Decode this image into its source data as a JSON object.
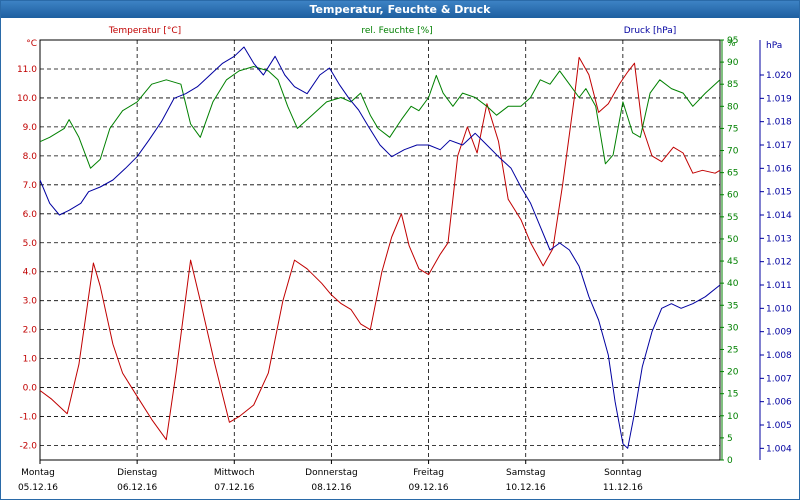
{
  "window": {
    "title": "Temperatur, Feuchte & Druck"
  },
  "colors": {
    "temperature": "#c00000",
    "humidity": "#008000",
    "pressure": "#0000a0",
    "grid": "#000000"
  },
  "chart_data": {
    "type": "line",
    "title": "Temperatur, Feuchte & Druck",
    "headers": {
      "temperature": "Temperatur [°C]",
      "humidity": "rel. Feuchte [%]",
      "pressure": "Druck [hPa]"
    },
    "axes": {
      "temperature": {
        "unit": "°C",
        "range": [
          -2.5,
          12.0
        ],
        "ticks": [
          "11.0",
          "10.0",
          "9.0",
          "8.0",
          "7.0",
          "6.0",
          "5.0",
          "4.0",
          "3.0",
          "2.0",
          "1.0",
          "0.0",
          "-1.0",
          "-2.0"
        ]
      },
      "humidity": {
        "unit": "%",
        "range": [
          0,
          95
        ],
        "ticks": [
          "95",
          "90",
          "85",
          "80",
          "75",
          "70",
          "65",
          "60",
          "55",
          "50",
          "45",
          "40",
          "35",
          "30",
          "25",
          "20",
          "15",
          "10",
          "5",
          "0"
        ]
      },
      "pressure": {
        "unit": "hPa",
        "range": [
          1.0035,
          1.0215
        ],
        "ticks": [
          "1.020",
          "1.019",
          "1.018",
          "1.017",
          "1.016",
          "1.015",
          "1.014",
          "1.013",
          "1.012",
          "1.011",
          "1.010",
          "1.009",
          "1.008",
          "1.007",
          "1.006",
          "1.005",
          "1.004"
        ]
      }
    },
    "x_range_days": [
      0,
      7
    ],
    "days": [
      {
        "weekday": "Montag",
        "date": "05.12.16"
      },
      {
        "weekday": "Dienstag",
        "date": "06.12.16"
      },
      {
        "weekday": "Mittwoch",
        "date": "07.12.16"
      },
      {
        "weekday": "Donnerstag",
        "date": "08.12.16"
      },
      {
        "weekday": "Freitag",
        "date": "09.12.16"
      },
      {
        "weekday": "Samstag",
        "date": "10.12.16"
      },
      {
        "weekday": "Sonntag",
        "date": "11.12.16"
      }
    ],
    "grid": true,
    "series": [
      {
        "name": "Temperatur [°C]",
        "axis": "temperature",
        "points": [
          [
            0,
            -0.1
          ],
          [
            0.12,
            -0.4
          ],
          [
            0.28,
            -0.9
          ],
          [
            0.4,
            0.8
          ],
          [
            0.55,
            4.3
          ],
          [
            0.62,
            3.5
          ],
          [
            0.75,
            1.5
          ],
          [
            0.85,
            0.5
          ],
          [
            1.0,
            -0.3
          ],
          [
            1.15,
            -1.1
          ],
          [
            1.3,
            -1.8
          ],
          [
            1.4,
            0.5
          ],
          [
            1.55,
            4.4
          ],
          [
            1.65,
            3.0
          ],
          [
            1.8,
            0.8
          ],
          [
            1.95,
            -1.2
          ],
          [
            2.05,
            -1.0
          ],
          [
            2.2,
            -0.6
          ],
          [
            2.35,
            0.5
          ],
          [
            2.5,
            3.0
          ],
          [
            2.62,
            4.4
          ],
          [
            2.75,
            4.1
          ],
          [
            2.9,
            3.6
          ],
          [
            3.0,
            3.2
          ],
          [
            3.1,
            2.9
          ],
          [
            3.2,
            2.7
          ],
          [
            3.3,
            2.2
          ],
          [
            3.4,
            2.0
          ],
          [
            3.52,
            4.0
          ],
          [
            3.62,
            5.2
          ],
          [
            3.72,
            6.0
          ],
          [
            3.8,
            4.9
          ],
          [
            3.9,
            4.1
          ],
          [
            4.0,
            3.9
          ],
          [
            4.12,
            4.6
          ],
          [
            4.2,
            5.0
          ],
          [
            4.3,
            8.0
          ],
          [
            4.4,
            9.0
          ],
          [
            4.5,
            8.1
          ],
          [
            4.6,
            9.8
          ],
          [
            4.72,
            8.5
          ],
          [
            4.82,
            6.5
          ],
          [
            4.95,
            5.8
          ],
          [
            5.05,
            5.0
          ],
          [
            5.18,
            4.2
          ],
          [
            5.28,
            4.8
          ],
          [
            5.38,
            7.0
          ],
          [
            5.5,
            10.0
          ],
          [
            5.55,
            11.4
          ],
          [
            5.65,
            10.8
          ],
          [
            5.75,
            9.5
          ],
          [
            5.85,
            9.8
          ],
          [
            5.97,
            10.5
          ],
          [
            6.05,
            10.9
          ],
          [
            6.12,
            11.2
          ],
          [
            6.2,
            9.0
          ],
          [
            6.3,
            8.0
          ],
          [
            6.4,
            7.8
          ],
          [
            6.52,
            8.3
          ],
          [
            6.62,
            8.1
          ],
          [
            6.72,
            7.4
          ],
          [
            6.82,
            7.5
          ],
          [
            6.95,
            7.4
          ],
          [
            7.0,
            7.5
          ]
        ]
      },
      {
        "name": "rel. Feuchte [%]",
        "axis": "humidity",
        "points": [
          [
            0,
            72
          ],
          [
            0.1,
            73
          ],
          [
            0.25,
            75
          ],
          [
            0.3,
            77
          ],
          [
            0.4,
            73
          ],
          [
            0.52,
            66
          ],
          [
            0.62,
            68
          ],
          [
            0.72,
            75
          ],
          [
            0.85,
            79
          ],
          [
            1.0,
            81
          ],
          [
            1.15,
            85
          ],
          [
            1.3,
            86
          ],
          [
            1.45,
            85
          ],
          [
            1.55,
            76
          ],
          [
            1.65,
            73
          ],
          [
            1.78,
            81
          ],
          [
            1.92,
            86
          ],
          [
            2.05,
            88
          ],
          [
            2.2,
            89
          ],
          [
            2.35,
            88
          ],
          [
            2.45,
            86
          ],
          [
            2.55,
            80
          ],
          [
            2.65,
            75
          ],
          [
            2.8,
            78
          ],
          [
            2.95,
            81
          ],
          [
            3.1,
            82
          ],
          [
            3.2,
            81
          ],
          [
            3.3,
            83
          ],
          [
            3.4,
            78
          ],
          [
            3.48,
            75
          ],
          [
            3.6,
            73
          ],
          [
            3.72,
            77
          ],
          [
            3.82,
            80
          ],
          [
            3.9,
            79
          ],
          [
            4.0,
            82
          ],
          [
            4.08,
            87
          ],
          [
            4.15,
            83
          ],
          [
            4.25,
            80
          ],
          [
            4.35,
            83
          ],
          [
            4.48,
            82
          ],
          [
            4.6,
            80
          ],
          [
            4.7,
            78
          ],
          [
            4.82,
            80
          ],
          [
            4.95,
            80
          ],
          [
            5.05,
            82
          ],
          [
            5.15,
            86
          ],
          [
            5.25,
            85
          ],
          [
            5.35,
            88
          ],
          [
            5.45,
            85
          ],
          [
            5.55,
            82
          ],
          [
            5.62,
            84
          ],
          [
            5.72,
            80
          ],
          [
            5.82,
            67
          ],
          [
            5.9,
            69
          ],
          [
            6.0,
            81
          ],
          [
            6.1,
            74
          ],
          [
            6.18,
            73
          ],
          [
            6.28,
            83
          ],
          [
            6.38,
            86
          ],
          [
            6.5,
            84
          ],
          [
            6.62,
            83
          ],
          [
            6.72,
            80
          ],
          [
            6.85,
            83
          ],
          [
            7.0,
            86
          ]
        ]
      },
      {
        "name": "Druck [hPa]",
        "axis": "pressure",
        "points": [
          [
            0,
            1.0155
          ],
          [
            0.1,
            1.0145
          ],
          [
            0.2,
            1.014
          ],
          [
            0.3,
            1.0142
          ],
          [
            0.42,
            1.0145
          ],
          [
            0.5,
            1.015
          ],
          [
            0.62,
            1.0152
          ],
          [
            0.75,
            1.0155
          ],
          [
            0.88,
            1.016
          ],
          [
            1.0,
            1.0165
          ],
          [
            1.12,
            1.0172
          ],
          [
            1.25,
            1.018
          ],
          [
            1.38,
            1.019
          ],
          [
            1.5,
            1.0192
          ],
          [
            1.62,
            1.0195
          ],
          [
            1.75,
            1.02
          ],
          [
            1.88,
            1.0205
          ],
          [
            2.0,
            1.0208
          ],
          [
            2.1,
            1.0212
          ],
          [
            2.2,
            1.0205
          ],
          [
            2.3,
            1.02
          ],
          [
            2.42,
            1.0208
          ],
          [
            2.52,
            1.02
          ],
          [
            2.62,
            1.0195
          ],
          [
            2.75,
            1.0192
          ],
          [
            2.88,
            1.02
          ],
          [
            2.98,
            1.0203
          ],
          [
            3.08,
            1.0196
          ],
          [
            3.18,
            1.019
          ],
          [
            3.28,
            1.0185
          ],
          [
            3.38,
            1.0178
          ],
          [
            3.5,
            1.017
          ],
          [
            3.62,
            1.0165
          ],
          [
            3.75,
            1.0168
          ],
          [
            3.88,
            1.017
          ],
          [
            4.0,
            1.017
          ],
          [
            4.12,
            1.0168
          ],
          [
            4.22,
            1.0172
          ],
          [
            4.35,
            1.017
          ],
          [
            4.48,
            1.0175
          ],
          [
            4.6,
            1.017
          ],
          [
            4.72,
            1.0165
          ],
          [
            4.85,
            1.016
          ],
          [
            4.95,
            1.0152
          ],
          [
            5.05,
            1.0145
          ],
          [
            5.15,
            1.0135
          ],
          [
            5.25,
            1.0125
          ],
          [
            5.35,
            1.0128
          ],
          [
            5.45,
            1.0125
          ],
          [
            5.55,
            1.0118
          ],
          [
            5.65,
            1.0105
          ],
          [
            5.75,
            1.0095
          ],
          [
            5.85,
            1.008
          ],
          [
            5.92,
            1.006
          ],
          [
            6.0,
            1.0042
          ],
          [
            6.05,
            1.004
          ],
          [
            6.12,
            1.0055
          ],
          [
            6.2,
            1.0075
          ],
          [
            6.3,
            1.009
          ],
          [
            6.4,
            1.01
          ],
          [
            6.5,
            1.0102
          ],
          [
            6.6,
            1.01
          ],
          [
            6.72,
            1.0102
          ],
          [
            6.85,
            1.0105
          ],
          [
            7.0,
            1.011
          ]
        ]
      }
    ]
  }
}
